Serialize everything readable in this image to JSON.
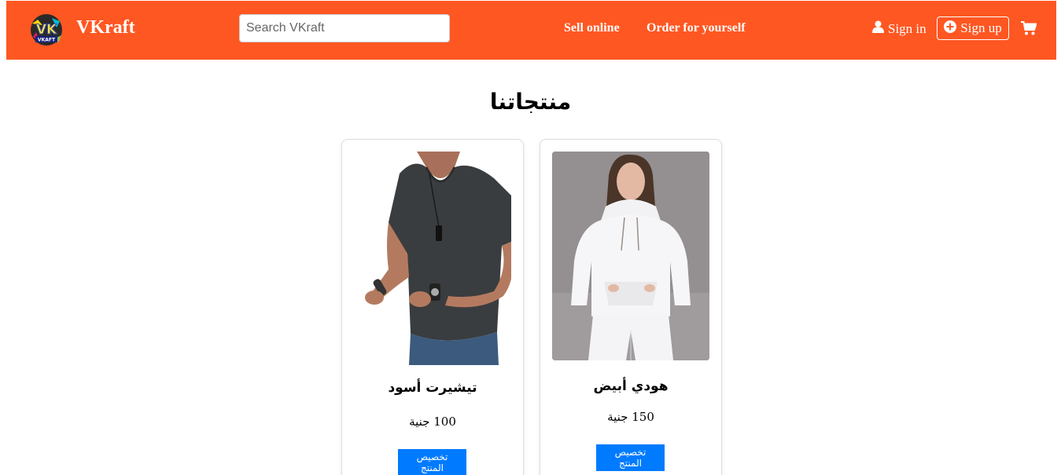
{
  "navbar": {
    "brand": "VKraft",
    "logo_text": "VK",
    "logo_subtext": "VKAFT",
    "search_placeholder": "Search VKraft",
    "links": [
      "Sell online",
      "Order for yourself"
    ],
    "signin_label": "Sign in",
    "signup_label": "Sign up",
    "cart_icon": "cart-icon",
    "background": "#ff5722"
  },
  "main": {
    "title": "منتجاتنا",
    "products": [
      {
        "name": "تيشيرت أسود",
        "price": "100 جنية",
        "button": "تخصيص المنتج",
        "image": "black-tshirt-model"
      },
      {
        "name": "هودي أبيض",
        "price": "150 جنية",
        "button": "تخصيص المنتج",
        "image": "white-hoodie-model"
      }
    ]
  },
  "colors": {
    "accent": "#ff5722",
    "button": "#007bff"
  }
}
